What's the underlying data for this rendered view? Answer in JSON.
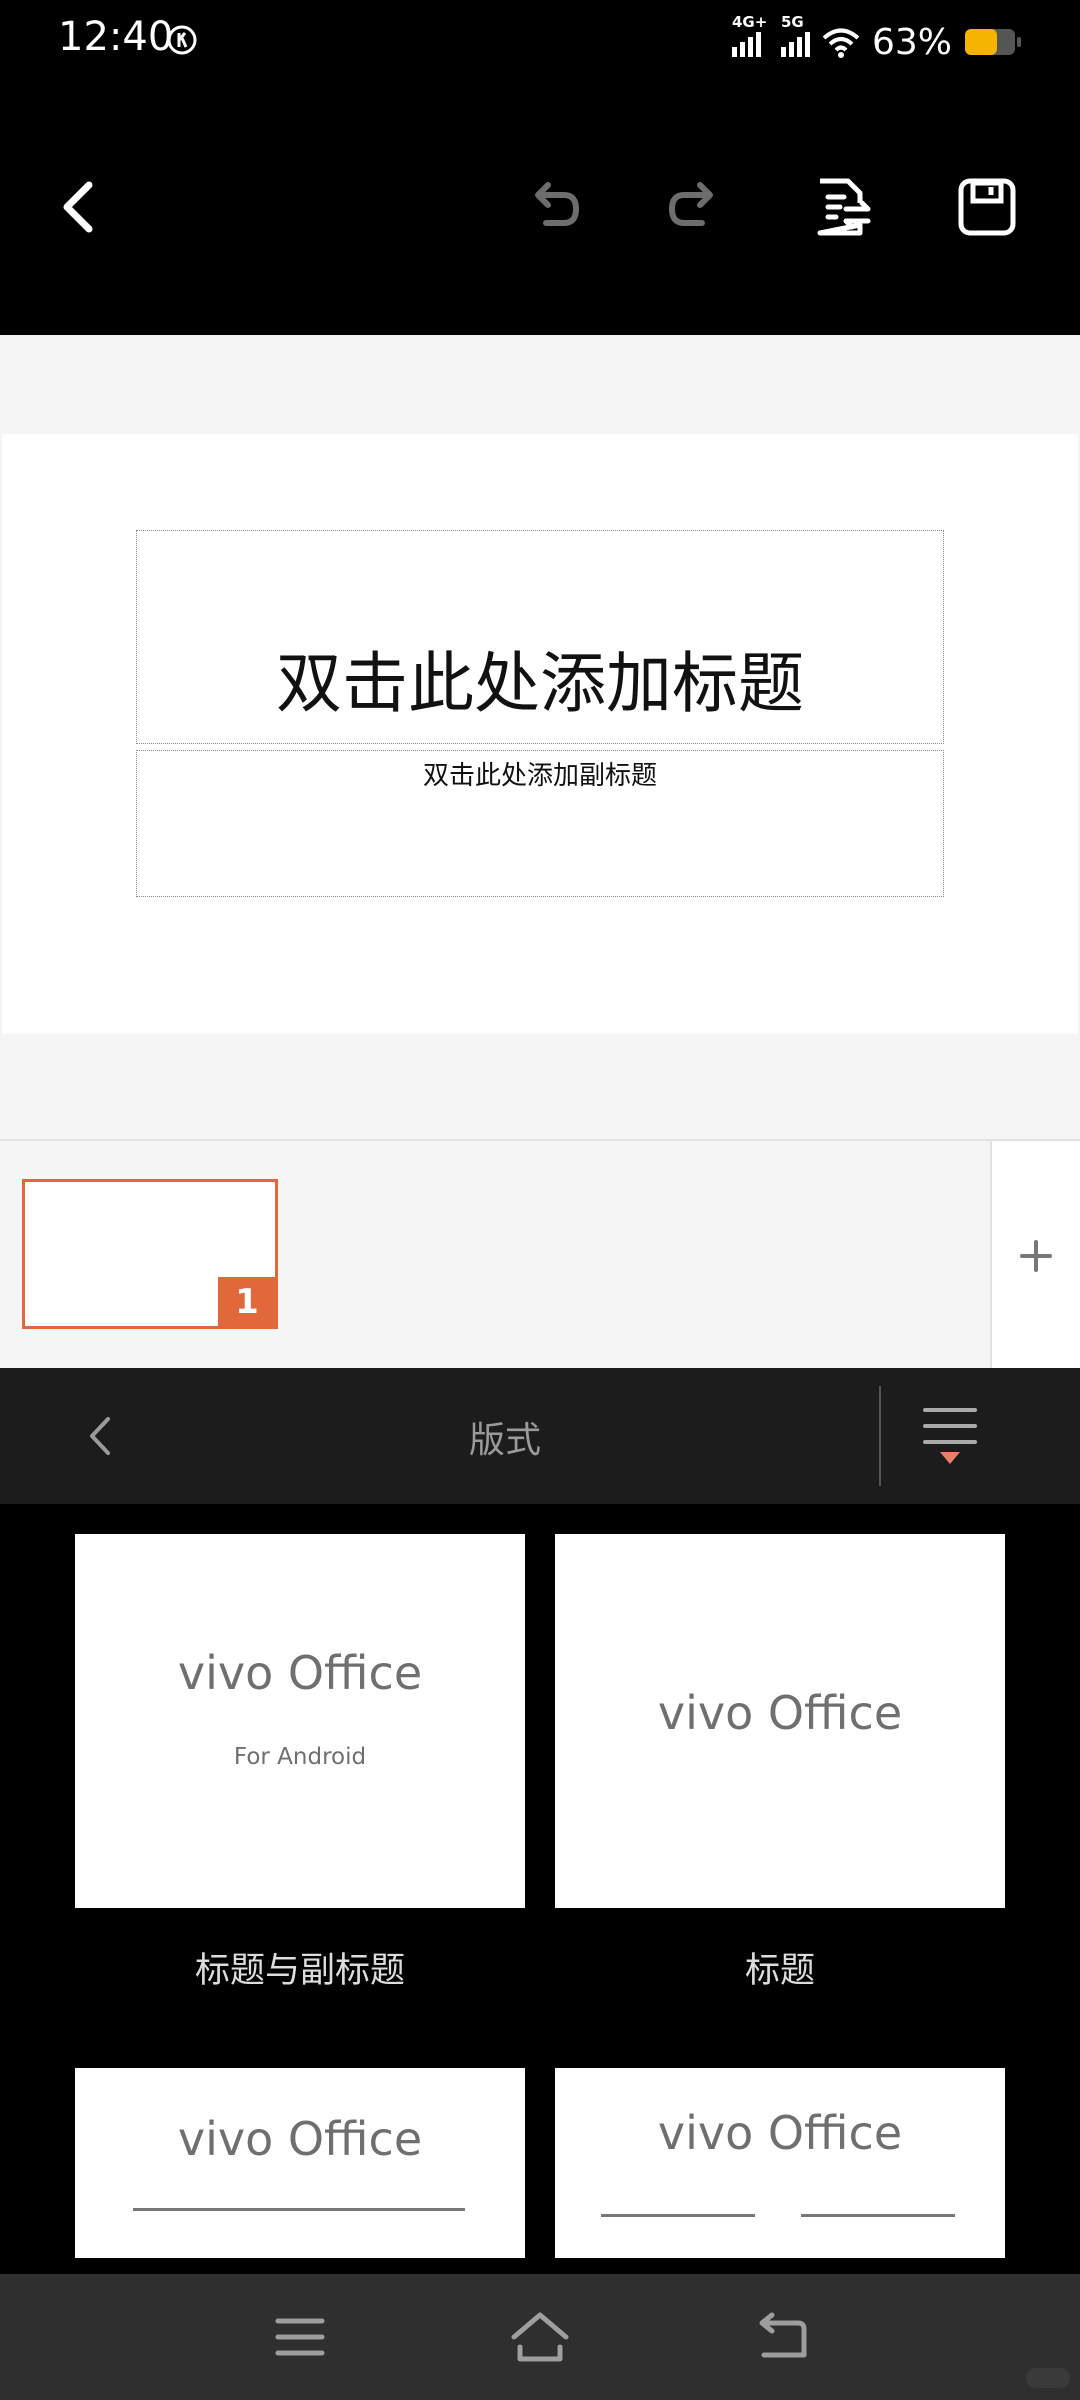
{
  "status_bar": {
    "time": "12:40",
    "network_1": "4G+",
    "network_2": "5G",
    "battery_percent": "63%",
    "battery_level": 0.63,
    "battery_color": "#f4b400"
  },
  "toolbar": {
    "back_icon": "chevron-left-icon",
    "undo_icon": "undo-icon",
    "redo_icon": "redo-icon",
    "export_icon": "document-convert-icon",
    "save_icon": "save-icon"
  },
  "slide": {
    "title_placeholder": "双击此处添加标题",
    "subtitle_placeholder": "双击此处添加副标题"
  },
  "thumbnails": {
    "items": [
      {
        "number": "1",
        "selected": true
      }
    ],
    "accent_color": "#e0683b",
    "add_icon": "plus-icon"
  },
  "panel": {
    "title": "版式",
    "back_icon": "chevron-left-icon",
    "menu_icon": "list-collapse-icon"
  },
  "layouts": [
    {
      "label": "标题与副标题",
      "preview_title": "vivo  Office",
      "preview_subtitle": "For Android"
    },
    {
      "label": "标题",
      "preview_title": "vivo  Office"
    },
    {
      "preview_title": "vivo  Office"
    },
    {
      "preview_title": "vivo  Office"
    }
  ],
  "nav_bar": {
    "menu_icon": "menu-icon",
    "home_icon": "home-icon",
    "back_icon": "back-icon"
  }
}
